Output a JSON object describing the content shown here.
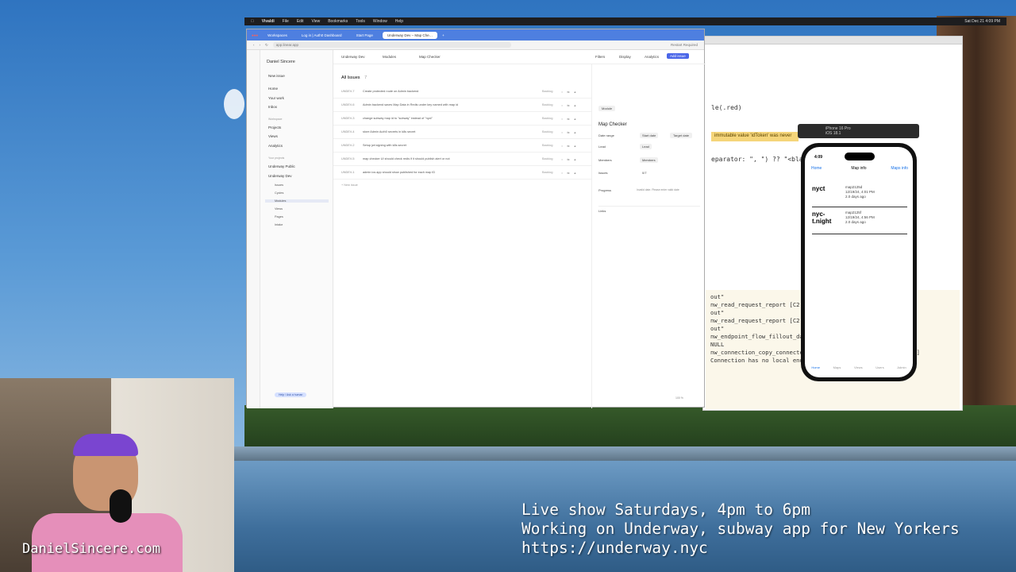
{
  "menubar": {
    "app": "Vivaldi",
    "items": [
      "File",
      "Edit",
      "View",
      "Bookmarks",
      "Tools",
      "Window",
      "Help"
    ],
    "clock": "Sat Dec 21  4:09 PM"
  },
  "browser": {
    "tabs": [
      "Workspaces",
      "Log in | Auth0 Dashboard",
      "Start Page",
      "Underway Dev – Map Che…"
    ],
    "url": "app.linear.app",
    "relaunch_label": "Restart Required",
    "workspace_name": "Daniel Sincere",
    "sidebar": {
      "new_issue": "New issue",
      "items": [
        "Home",
        "Your work",
        "Inbox"
      ],
      "workspace_section": "Workspace",
      "workspace_items": [
        "Projects",
        "Views",
        "Analytics"
      ],
      "projects_section": "Your projects",
      "projects": [
        "Underway Public",
        "Underway Dev"
      ],
      "dev_subitems": [
        "Issues",
        "Cycles",
        "Modules",
        "Views",
        "Pages",
        "Intake"
      ],
      "help_badge": "Help / Ask a human"
    },
    "topbar": {
      "breadcrumb_project": "Underway Dev",
      "breadcrumb_section": "Modules",
      "module_name": "Map Checker",
      "filters": "Filters",
      "display": "Display",
      "analytics": "Analytics",
      "add_issue": "Add issue"
    },
    "issues_header": "All Issues",
    "issues_count": "7",
    "issues": [
      {
        "id": "UNDEV-7",
        "title": "Create protected route on Admin backend",
        "status": "Backlog"
      },
      {
        "id": "UNDEV-6",
        "title": "Admin backend saves Map Data in Redis under key named with map id",
        "status": "Backlog"
      },
      {
        "id": "UNDEV-3",
        "title": "change subway map id to \"subway\" instead of \"nyct\"",
        "status": "Backlog"
      },
      {
        "id": "UNDEV-4",
        "title": "store Admin Auth0 secrets in k8s secret",
        "status": "Backlog"
      },
      {
        "id": "UNDEV-2",
        "title": "Setup jwt signing with k8s secret",
        "status": "Backlog"
      },
      {
        "id": "UNDEV-5",
        "title": "map checker UI should check redis if it should publish alert or not",
        "status": "Backlog"
      },
      {
        "id": "UNDEV-1",
        "title": "admin ios app should show published for each map ID",
        "status": "Backlog"
      }
    ],
    "new_issue_row": "+ New issue",
    "detail": {
      "module_badge": "Module",
      "title": "Map Checker",
      "fields": [
        {
          "label": "Date range",
          "value": "Start date"
        },
        {
          "label": "Lead",
          "value": "Lead"
        },
        {
          "label": "Members",
          "value": "Members"
        },
        {
          "label": "Issues",
          "value": "0/7"
        }
      ],
      "target_date": "Target date",
      "progress_label": "Progress",
      "progress_note": "Invalid date. Please enter valid date",
      "links_label": "Links"
    },
    "status_zoom": "100 %"
  },
  "xcode": {
    "code_line": "le(.red)",
    "warning": "immutable value 'idToken' was never",
    "separator_line": "eparator: \", \") ?? \"<blank p",
    "console_lines": [
      "out\"",
      "nw_read_request_report [C2        tion timed",
      "out\"",
      "nw_read_request_report [C2        tion timed",
      "out\"",
      "nw_endpoint_flow_fillout_da        returned",
      "NULL",
      "nw_connection_copy_connected_local_endpoint_block_invoke [C2]",
      "Connection has no local endpoint"
    ],
    "simulator_title": "iPhone 16 Pro",
    "simulator_os": "iOS 18.1"
  },
  "phone": {
    "time": "4:09",
    "back": "Home",
    "title": "Map info",
    "action": "Maps info",
    "maps": [
      {
        "name": "nyct",
        "id": "map2125d",
        "date": "12/19/24, 4:01 PM",
        "ago": "2.0 days ago"
      },
      {
        "name": "nyc-t.night",
        "id": "map2125f",
        "date": "12/19/24, 4:56 PM",
        "ago": "2.0 days ago"
      }
    ],
    "tabs": [
      "Home",
      "Maps",
      "Views",
      "Users",
      "Admin"
    ]
  },
  "webcam": {
    "brand": "DanielSincere.com"
  },
  "overlay": {
    "line1": "Live show Saturdays, 4pm to 6pm",
    "line2": "Working on Underway, subway app for New Yorkers",
    "line3": "https://underway.nyc"
  }
}
